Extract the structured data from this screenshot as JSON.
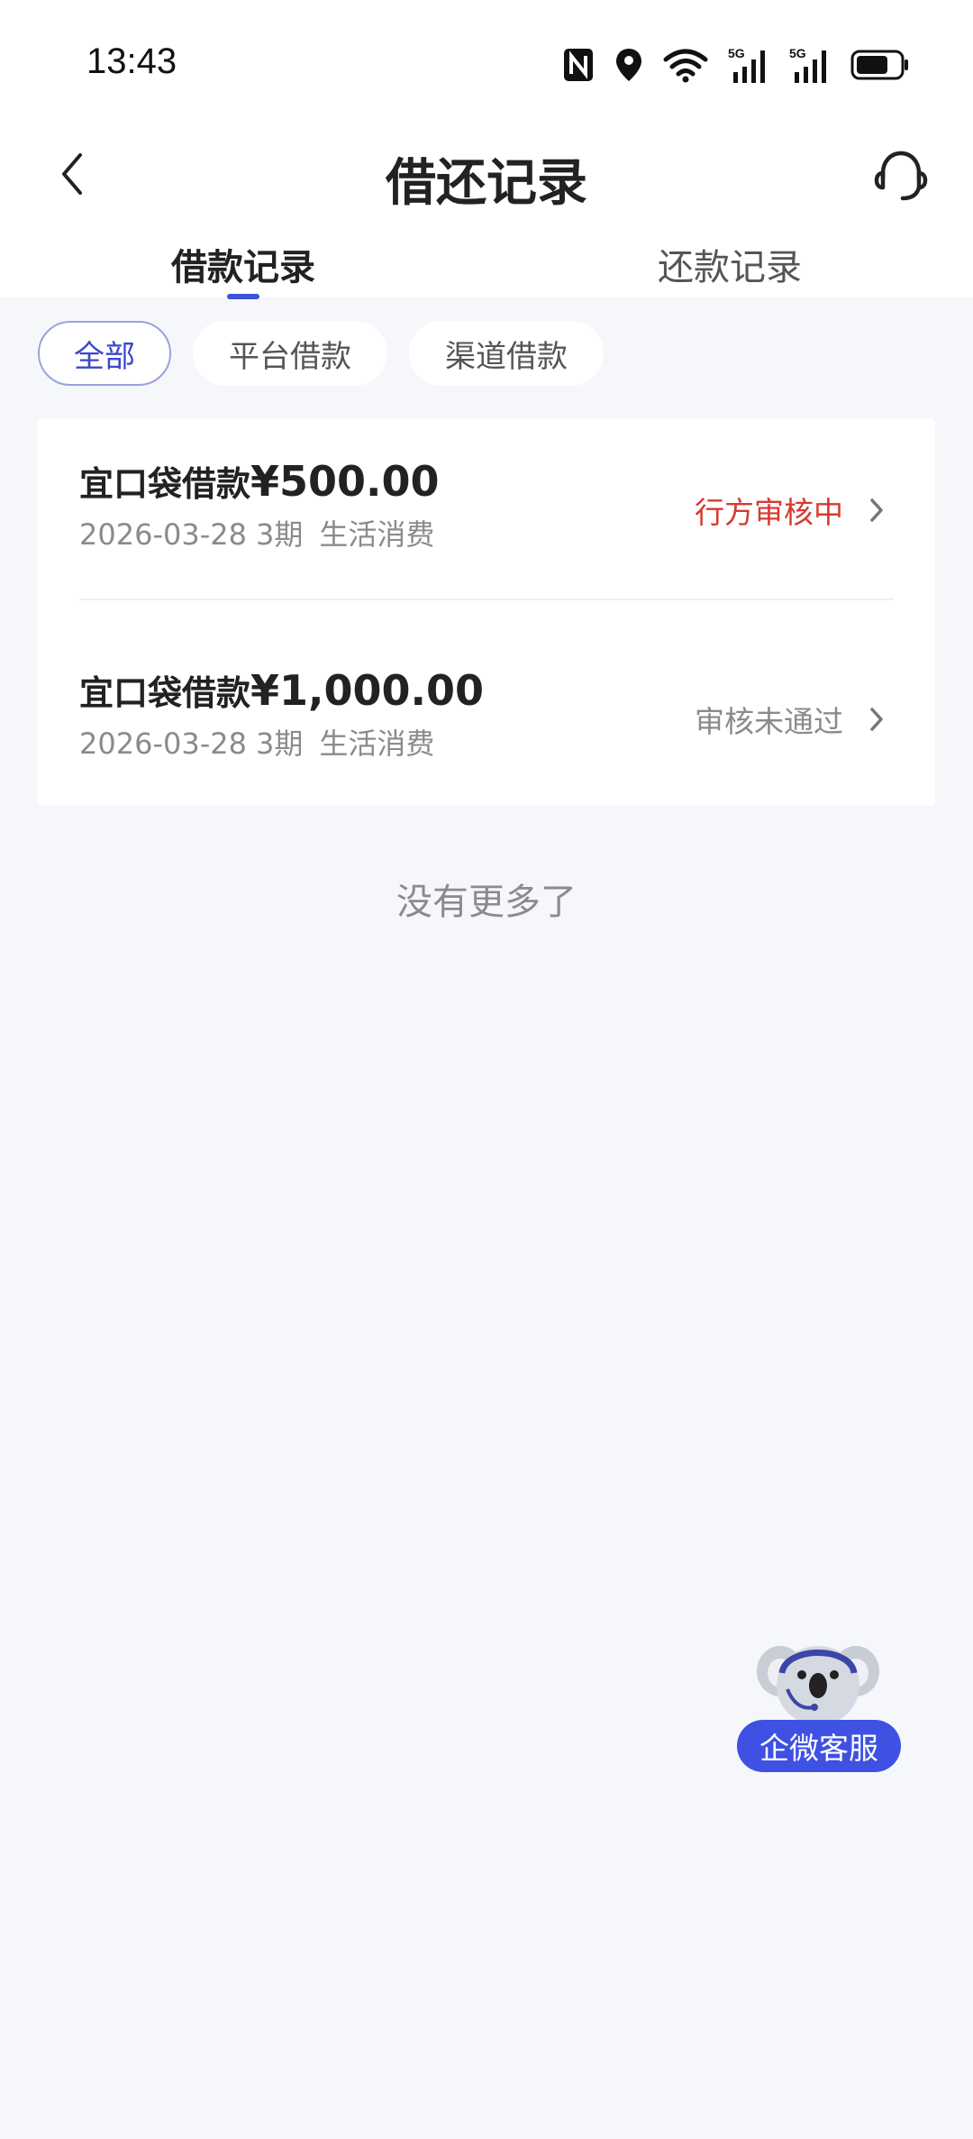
{
  "status_bar": {
    "time": "13:43",
    "icons": [
      "nfc-icon",
      "location-icon",
      "wifi-icon",
      "5g-signal-icon",
      "5g-signal-icon",
      "battery-icon"
    ],
    "signal_label": "5G"
  },
  "header": {
    "title": "借还记录",
    "back_icon": "chevron-left-icon",
    "support_icon": "headset-icon"
  },
  "tabs": [
    {
      "label": "借款记录",
      "active": true
    },
    {
      "label": "还款记录",
      "active": false
    }
  ],
  "filters": [
    {
      "label": "全部",
      "active": true
    },
    {
      "label": "平台借款",
      "active": false
    },
    {
      "label": "渠道借款",
      "active": false
    }
  ],
  "records": [
    {
      "name": "宜口袋借款",
      "amount": "¥500.00",
      "date": "2026-03-28",
      "term": "3期",
      "purpose": "生活消费",
      "status": "行方审核中",
      "status_color": "#d8392f"
    },
    {
      "name": "宜口袋借款",
      "amount": "¥1,000.00",
      "date": "2026-03-28",
      "term": "3期",
      "purpose": "生活消费",
      "status": "审核未通过",
      "status_color": "#8a8a8f"
    }
  ],
  "footer_text": "没有更多了",
  "float_service": {
    "label": "企微客服",
    "icon": "koala-mascot-icon",
    "color": "#3e51e3"
  },
  "colors": {
    "accent": "#3f51d6",
    "background": "#f6f7fb"
  }
}
